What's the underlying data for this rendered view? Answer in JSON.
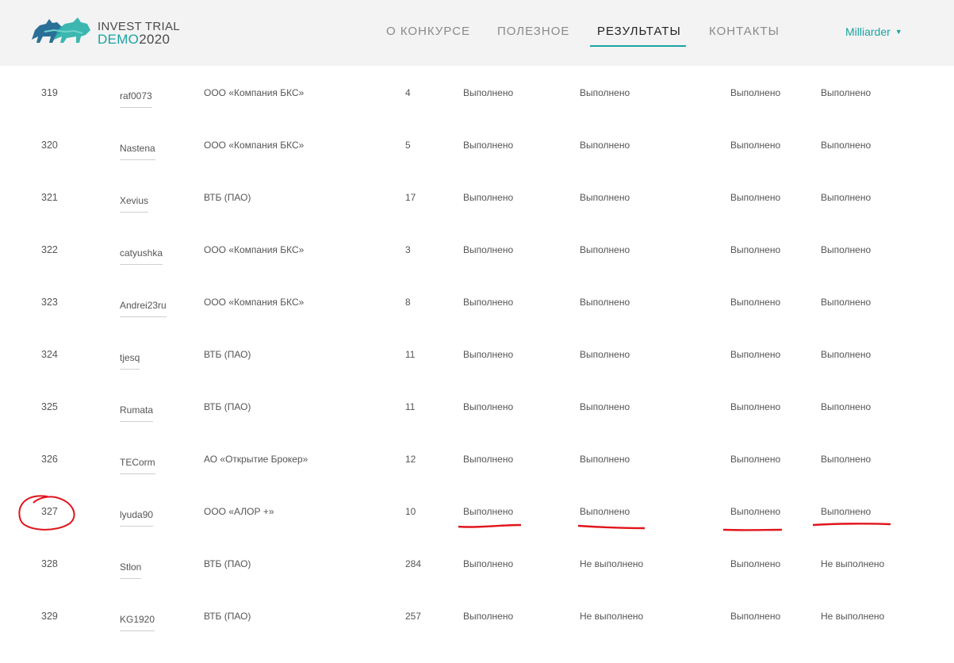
{
  "header": {
    "logo": {
      "line1": "INVEST TRIAL",
      "demo": "DEMO",
      "year": "2020",
      "icon": "bull-bear-logo-icon"
    },
    "nav": [
      {
        "label": "О КОНКУРСЕ",
        "active": false
      },
      {
        "label": "ПОЛЕЗНОЕ",
        "active": false
      },
      {
        "label": "РЕЗУЛЬТАТЫ",
        "active": true
      },
      {
        "label": "КОНТАКТЫ",
        "active": false
      }
    ],
    "user": {
      "name": "Milliarder",
      "icon": "caret-down-icon"
    }
  },
  "rows": [
    {
      "num": "319",
      "user": "raf0073",
      "broker": "ООО «Компания БКС»",
      "count": "4",
      "s1": "Выполнено",
      "s2": "Выполнено",
      "s3": "Выполнено",
      "s4": "Выполнено"
    },
    {
      "num": "320",
      "user": "Nastena",
      "broker": "ООО «Компания БКС»",
      "count": "5",
      "s1": "Выполнено",
      "s2": "Выполнено",
      "s3": "Выполнено",
      "s4": "Выполнено"
    },
    {
      "num": "321",
      "user": "Xevius",
      "broker": "ВТБ (ПАО)",
      "count": "17",
      "s1": "Выполнено",
      "s2": "Выполнено",
      "s3": "Выполнено",
      "s4": "Выполнено"
    },
    {
      "num": "322",
      "user": "catyushka",
      "broker": "ООО «Компания БКС»",
      "count": "3",
      "s1": "Выполнено",
      "s2": "Выполнено",
      "s3": "Выполнено",
      "s4": "Выполнено"
    },
    {
      "num": "323",
      "user": "Andrei23ru",
      "broker": "ООО «Компания БКС»",
      "count": "8",
      "s1": "Выполнено",
      "s2": "Выполнено",
      "s3": "Выполнено",
      "s4": "Выполнено"
    },
    {
      "num": "324",
      "user": "tjesq",
      "broker": "ВТБ (ПАО)",
      "count": "11",
      "s1": "Выполнено",
      "s2": "Выполнено",
      "s3": "Выполнено",
      "s4": "Выполнено"
    },
    {
      "num": "325",
      "user": "Rumata",
      "broker": "ВТБ (ПАО)",
      "count": "11",
      "s1": "Выполнено",
      "s2": "Выполнено",
      "s3": "Выполнено",
      "s4": "Выполнено"
    },
    {
      "num": "326",
      "user": "TECorm",
      "broker": "АО «Открытие Брокер»",
      "count": "12",
      "s1": "Выполнено",
      "s2": "Выполнено",
      "s3": "Выполнено",
      "s4": "Выполнено"
    },
    {
      "num": "327",
      "user": "lyuda90",
      "broker": "ООО «АЛОР +»",
      "count": "10",
      "s1": "Выполнено",
      "s2": "Выполнено",
      "s3": "Выполнено",
      "s4": "Выполнено"
    },
    {
      "num": "328",
      "user": "Stlon",
      "broker": "ВТБ (ПАО)",
      "count": "284",
      "s1": "Выполнено",
      "s2": "Не выполнено",
      "s3": "Выполнено",
      "s4": "Не выполнено"
    },
    {
      "num": "329",
      "user": "KG1920",
      "broker": "ВТБ (ПАО)",
      "count": "257",
      "s1": "Выполнено",
      "s2": "Не выполнено",
      "s3": "Выполнено",
      "s4": "Не выполнено"
    }
  ],
  "annotation_color": "#e0151b"
}
